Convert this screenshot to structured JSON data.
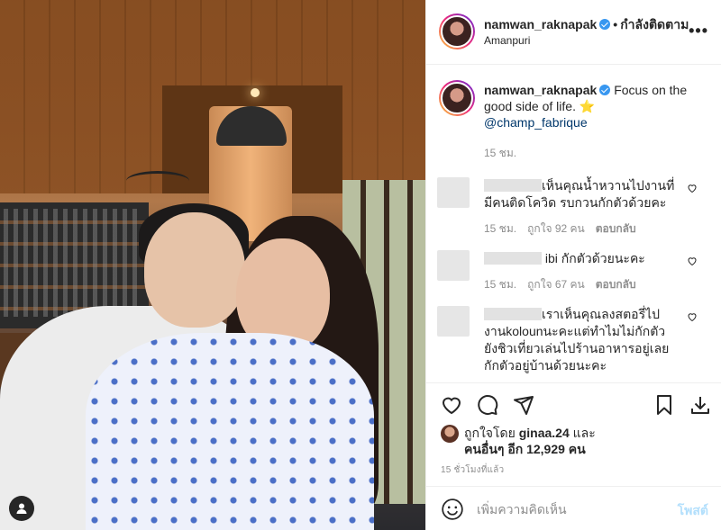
{
  "post": {
    "username": "namwan_raknapak",
    "follow_status": "กำลังติดตาม",
    "location": "Amanpuri",
    "more": "•••"
  },
  "caption": {
    "username": "namwan_raknapak",
    "text": "Focus on the good side of life.",
    "emoji": "⭐",
    "mention": "@champ_fabrique",
    "time": "15 ชม."
  },
  "comments": [
    {
      "text": "เห็นคุณน้ำหวานไปงานที่มีคนติดโควิด รบกวนกักตัวด้วยคะ",
      "time": "15 ชม.",
      "likes": "ถูกใจ 92 คน",
      "reply": "ตอบกลับ"
    },
    {
      "text": "ibi กักตัวด้วยนะคะ",
      "time": "15 ชม.",
      "likes": "ถูกใจ 67 คน",
      "reply": "ตอบกลับ"
    },
    {
      "text": "เราเห็นคุณลงสตอรี่ไปงานkolounนะคะแต่ทำไมไม่กักตัวยังชิวเที่ยวเล่นไปร้านอาหารอยู่เลย กักตัวอยู่บ้านด้วยนะคะ",
      "time": "",
      "likes": "",
      "reply": ""
    }
  ],
  "likes": {
    "prefix": "ถูกใจโดย",
    "user": "ginaa.24",
    "and": "และ",
    "others": "คนอื่นๆ อีก 12,929 คน"
  },
  "post_time": "15 ชั่วโมงที่แล้ว",
  "add_comment": {
    "placeholder": "เพิ่มความคิดเห็น",
    "post_label": "โพสต์"
  },
  "colors": {
    "accent": "#3897f0",
    "post_disabled": "#b2dffc",
    "muted": "#8e8e8e",
    "link": "#00376b"
  },
  "icons": [
    "heart-icon",
    "comment-icon",
    "share-icon",
    "bookmark-icon",
    "download-icon",
    "emoji-icon",
    "user-tag-icon",
    "verified-badge-icon"
  ]
}
